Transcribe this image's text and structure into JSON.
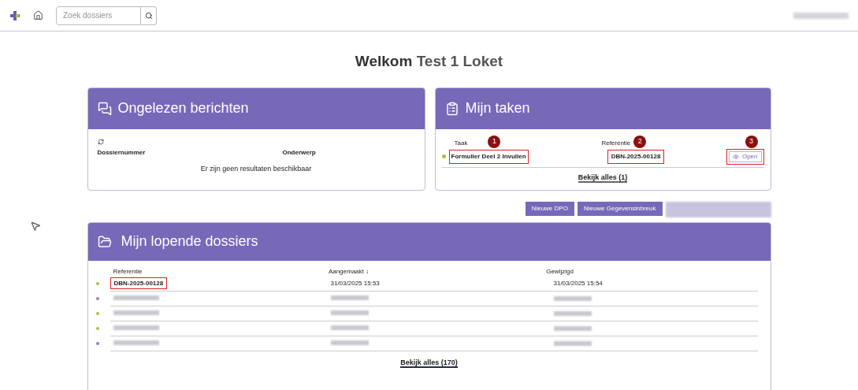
{
  "topbar": {
    "search": {
      "placeholder": "Zoek dossiers"
    }
  },
  "welcome": {
    "greeting": "Welkom",
    "name": "Test 1 Loket"
  },
  "messages": {
    "title": "Ongelezen berichten",
    "columns": [
      "Dossiernummer",
      "Onderwerp"
    ],
    "empty": "Er zijn geen resultaten beschikbaar"
  },
  "tasks": {
    "title": "Mijn taken",
    "columns": [
      "Taak",
      "Referentie"
    ],
    "rows": [
      {
        "task": "Formulier Deel 2 Invullen",
        "reference": "DBN-2025-00128",
        "action": "Open",
        "color": "#a8c43c"
      }
    ],
    "callouts": [
      "1",
      "2",
      "3"
    ],
    "view_all": "Bekijk alles (1)"
  },
  "actions": [
    "Nieuwe DPO",
    "Nieuwe Gegevensinbreuk"
  ],
  "dossiers": {
    "title": "Mijn lopende dossiers",
    "columns": [
      "Referentie",
      "Aangemaakt ↓",
      "Gewijzigd"
    ],
    "rows": [
      {
        "kind": "text",
        "highlighted": true,
        "color": "#a8c43c",
        "cells": [
          "DBN-2025-00128",
          "31/03/2025 15:53",
          "31/03/2025 15:54"
        ]
      },
      {
        "kind": "redacted",
        "highlighted": false,
        "color": "#8c84c0"
      },
      {
        "kind": "redacted",
        "highlighted": false,
        "color": "#a8c43c"
      },
      {
        "kind": "redacted",
        "highlighted": false,
        "color": "#a8c43c"
      },
      {
        "kind": "redacted",
        "highlighted": false,
        "color": "#8c84c0"
      }
    ],
    "view_all": "Bekijk alles (170)"
  }
}
